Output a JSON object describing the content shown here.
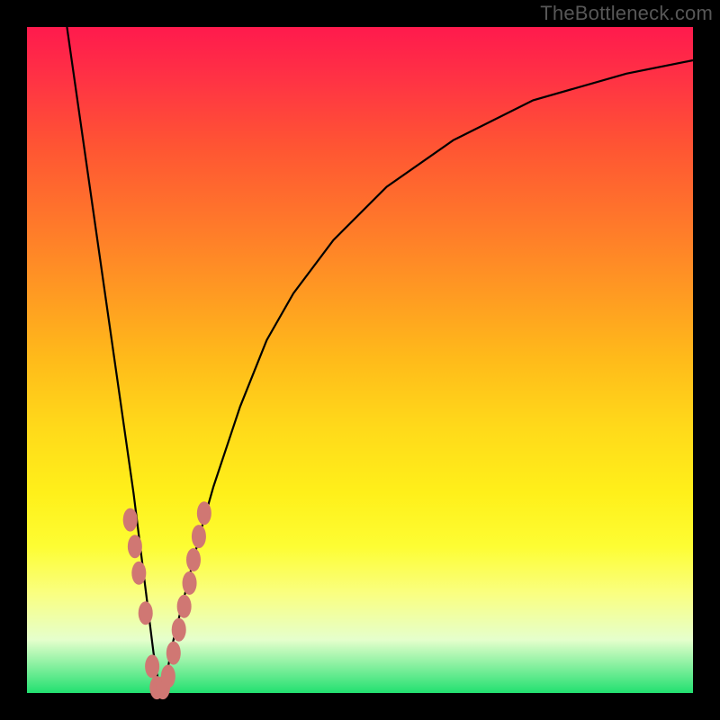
{
  "watermark": "TheBottleneck.com",
  "colors": {
    "frame": "#000000",
    "curve": "#000000",
    "dots": "#d07773",
    "gradient_top": "#ff1a4d",
    "gradient_bottom": "#22e070"
  },
  "chart_data": {
    "type": "line",
    "title": "",
    "xlabel": "",
    "ylabel": "",
    "xlim": [
      0,
      100
    ],
    "ylim": [
      0,
      100
    ],
    "grid": false,
    "legend": false,
    "description": "Bottleneck percentage vs component capability. V-shaped curve: steep descent from top-left, minimum near x≈20 at y≈0, then asymptotic rise toward top-right.",
    "series": [
      {
        "name": "bottleneck-curve",
        "x": [
          6,
          8,
          10,
          12,
          14,
          16,
          18,
          19,
          20,
          21,
          22,
          24,
          26,
          28,
          32,
          36,
          40,
          46,
          54,
          64,
          76,
          90,
          100
        ],
        "y": [
          100,
          86,
          72,
          58,
          44,
          30,
          14,
          6,
          0,
          3,
          8,
          16,
          24,
          31,
          43,
          53,
          60,
          68,
          76,
          83,
          89,
          93,
          95
        ]
      }
    ],
    "markers": [
      {
        "x": 15.5,
        "y": 26
      },
      {
        "x": 16.2,
        "y": 22
      },
      {
        "x": 16.8,
        "y": 18
      },
      {
        "x": 17.8,
        "y": 12
      },
      {
        "x": 18.8,
        "y": 4
      },
      {
        "x": 19.5,
        "y": 0.8
      },
      {
        "x": 20.4,
        "y": 0.8
      },
      {
        "x": 21.2,
        "y": 2.5
      },
      {
        "x": 22.0,
        "y": 6
      },
      {
        "x": 22.8,
        "y": 9.5
      },
      {
        "x": 23.6,
        "y": 13
      },
      {
        "x": 24.4,
        "y": 16.5
      },
      {
        "x": 25.0,
        "y": 20
      },
      {
        "x": 25.8,
        "y": 23.5
      },
      {
        "x": 26.6,
        "y": 27
      }
    ]
  }
}
